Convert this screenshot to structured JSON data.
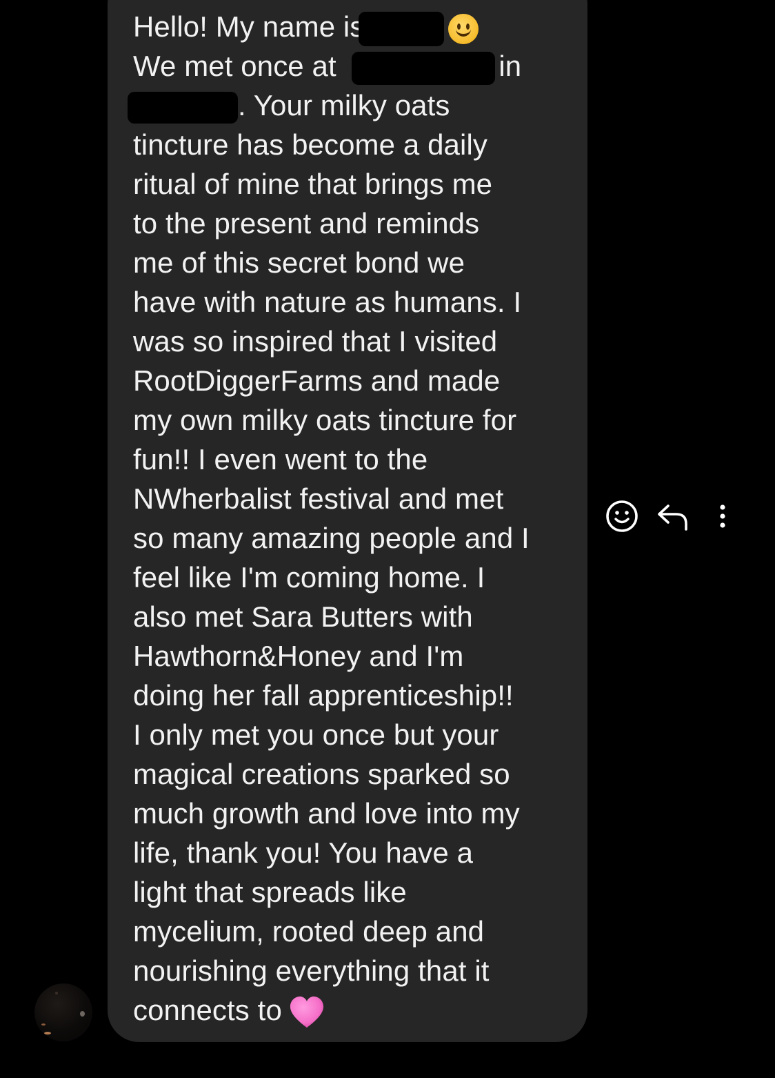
{
  "message": {
    "lines": [
      {
        "parts": [
          "Hello! My name is",
          ""
        ]
      },
      {
        "parts": [
          "We met once at ",
          " in"
        ]
      },
      {
        "parts": [
          "",
          ". Your milky oats"
        ]
      },
      {
        "parts": [
          "tincture has become a daily"
        ]
      },
      {
        "parts": [
          "ritual of mine that brings me"
        ]
      },
      {
        "parts": [
          "to the present and reminds"
        ]
      },
      {
        "parts": [
          "me of this secret bond we"
        ]
      },
      {
        "parts": [
          "have with nature as humans. I"
        ]
      },
      {
        "parts": [
          "was so inspired that I visited"
        ]
      },
      {
        "parts": [
          "RootDiggerFarms and made"
        ]
      },
      {
        "parts": [
          "my own milky oats tincture for"
        ]
      },
      {
        "parts": [
          "fun!! I even went to the"
        ]
      },
      {
        "parts": [
          "NWherbalist festival and met"
        ]
      },
      {
        "parts": [
          "so many amazing people and I"
        ]
      },
      {
        "parts": [
          "feel like I'm coming home. I"
        ]
      },
      {
        "parts": [
          "also met Sara Butters with"
        ]
      },
      {
        "parts": [
          "Hawthorn&Honey and I'm"
        ]
      },
      {
        "parts": [
          "doing her fall apprenticeship!!"
        ]
      },
      {
        "parts": [
          "I only met you once but your"
        ]
      },
      {
        "parts": [
          "magical creations sparked so"
        ]
      },
      {
        "parts": [
          "much growth and love into my"
        ]
      },
      {
        "parts": [
          "life, thank you! You have a"
        ]
      },
      {
        "parts": [
          "light that spreads like"
        ]
      },
      {
        "parts": [
          "mycelium, rooted deep and"
        ]
      },
      {
        "parts": [
          "nourishing everything that it"
        ]
      },
      {
        "parts": [
          "connects to"
        ]
      }
    ],
    "emojis": {
      "greeting": "slightly-smiling-face",
      "closing": "pink-heart"
    }
  },
  "actions": [
    {
      "icon": "emoji-react-icon"
    },
    {
      "icon": "reply-icon"
    },
    {
      "icon": "more-options-icon"
    }
  ],
  "colors": {
    "background": "#000000",
    "bubble": "#262626",
    "text": "#f2f2f2",
    "icon": "#ffffff",
    "heart": "#f56fc8"
  }
}
